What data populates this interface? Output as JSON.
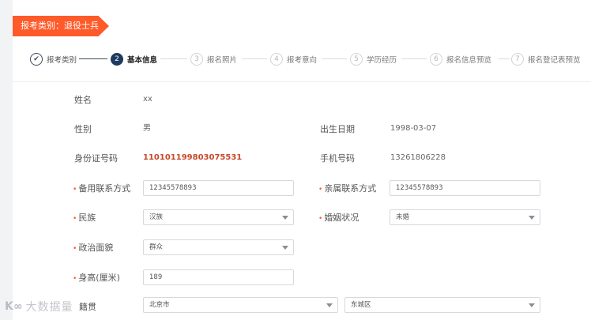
{
  "banner": {
    "label": "报考类别：退役士兵"
  },
  "stepper": {
    "steps": [
      {
        "number": "✔",
        "label": "报考类别",
        "state": "done"
      },
      {
        "number": "2",
        "label": "基本信息",
        "state": "active"
      },
      {
        "number": "3",
        "label": "报名照片",
        "state": "todo"
      },
      {
        "number": "4",
        "label": "报考意向",
        "state": "todo"
      },
      {
        "number": "5",
        "label": "学历经历",
        "state": "todo"
      },
      {
        "number": "6",
        "label": "报名信息预览",
        "state": "todo"
      },
      {
        "number": "7",
        "label": "报名登记表预览",
        "state": "todo"
      }
    ]
  },
  "form": {
    "name": {
      "label": "姓名",
      "value": "xx"
    },
    "gender": {
      "label": "性别",
      "value": "男"
    },
    "birth_date": {
      "label": "出生日期",
      "value": "1998-03-07"
    },
    "id_number": {
      "label": "身份证号码",
      "value": "110101199803075531"
    },
    "phone": {
      "label": "手机号码",
      "value": "13261806228"
    },
    "backup_contact": {
      "required": "•",
      "label": "备用联系方式",
      "value": "12345578893"
    },
    "family_contact": {
      "required": "•",
      "label": "亲属联系方式",
      "value": "12345578893"
    },
    "ethnicity": {
      "required": "•",
      "label": "民族",
      "value": "汉族"
    },
    "marital_status": {
      "required": "•",
      "label": "婚姻状况",
      "value": "未婚"
    },
    "political_status": {
      "required": "•",
      "label": "政治面貌",
      "value": "群众"
    },
    "height": {
      "required": "•",
      "label": "身高(厘米)",
      "value": "189"
    },
    "native_place": {
      "label": "籍贯",
      "province": "北京市",
      "district": "东城区"
    }
  },
  "watermark": {
    "logo": "K∞",
    "text": "大数据量"
  },
  "colors": {
    "accent": "#ff5a2a",
    "step_active": "#1f3a5f",
    "id_number": "#c8482a"
  }
}
